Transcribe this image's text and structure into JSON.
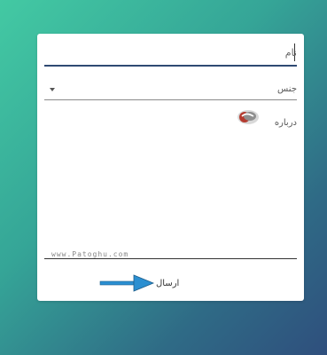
{
  "form": {
    "name_placeholder": "نام",
    "gender_label": "جنس",
    "about_label": "درباره",
    "watermark": "www.Patoghu.com",
    "submit_label": "ارسال"
  },
  "colors": {
    "background_start": "#43c9a3",
    "background_end": "#2f4f7d",
    "underline_active": "#2f4a73",
    "arrow": "#2b8fd1"
  },
  "icons": {
    "logo": "patoghu-logo",
    "dropdown": "chevron-down-icon",
    "arrow": "arrow-right-icon"
  }
}
